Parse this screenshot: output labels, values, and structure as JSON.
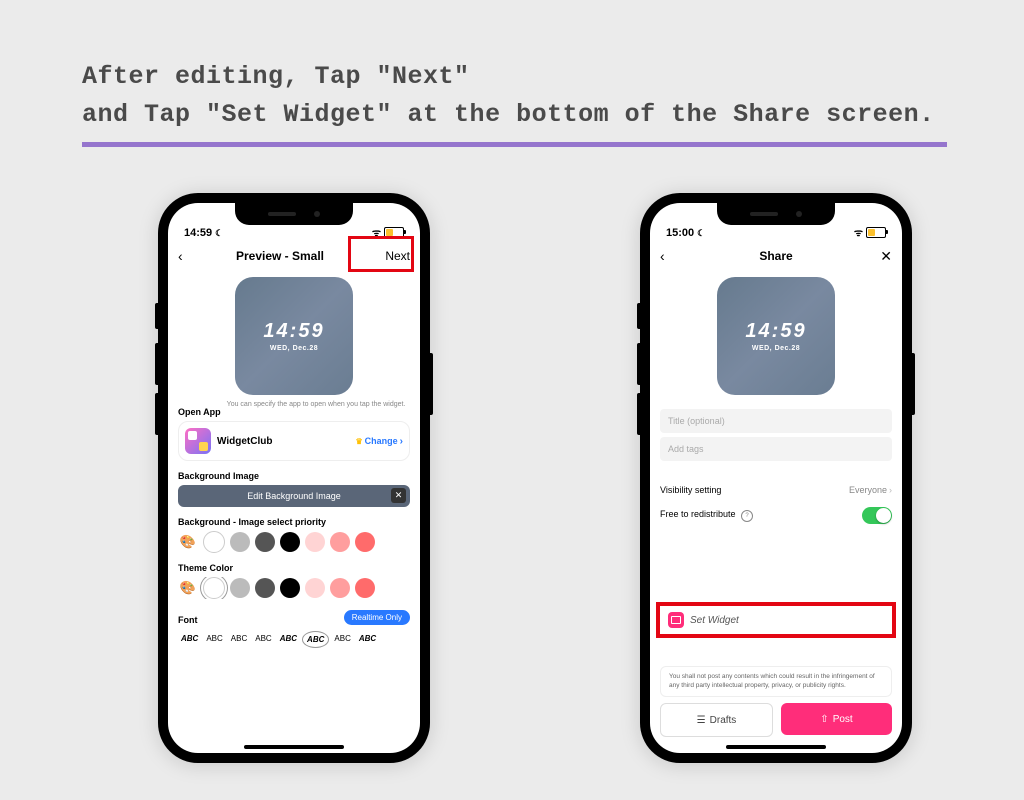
{
  "heading_line1": "After editing, Tap \"Next\"",
  "heading_line2": "and Tap \"Set Widget\" at the bottom of the Share screen.",
  "phone1": {
    "status_time": "14:59",
    "nav_title": "Preview - Small",
    "nav_next": "Next",
    "widget_time": "14:59",
    "widget_date": "WED, Dec.28",
    "open_app_label": "Open App",
    "open_app_desc": "You can specify the app to open when you tap the widget.",
    "app_name": "WidgetClub",
    "change_label": "Change",
    "bg_image_label": "Background Image",
    "edit_bg_label": "Edit Background Image",
    "bg_priority_label": "Background - Image select priority",
    "theme_color_label": "Theme Color",
    "font_label": "Font",
    "realtime_label": "Realtime Only",
    "abc_samples": [
      "ABC",
      "ABC",
      "ABC",
      "ABC",
      "ABC",
      "ABC",
      "ABC",
      "ABC"
    ]
  },
  "phone2": {
    "status_time": "15:00",
    "nav_title": "Share",
    "widget_time": "14:59",
    "widget_date": "WED, Dec.28",
    "title_placeholder": "Title (optional)",
    "tags_placeholder": "Add tags",
    "visibility_label": "Visibility setting",
    "visibility_value": "Everyone",
    "redistribute_label": "Free to redistribute",
    "set_widget_label": "Set Widget",
    "legal_text": "You shall not post any contents which could result in the infringement of any third party intellectual property, privacy, or publicity rights.",
    "drafts_label": "Drafts",
    "post_label": "Post"
  }
}
